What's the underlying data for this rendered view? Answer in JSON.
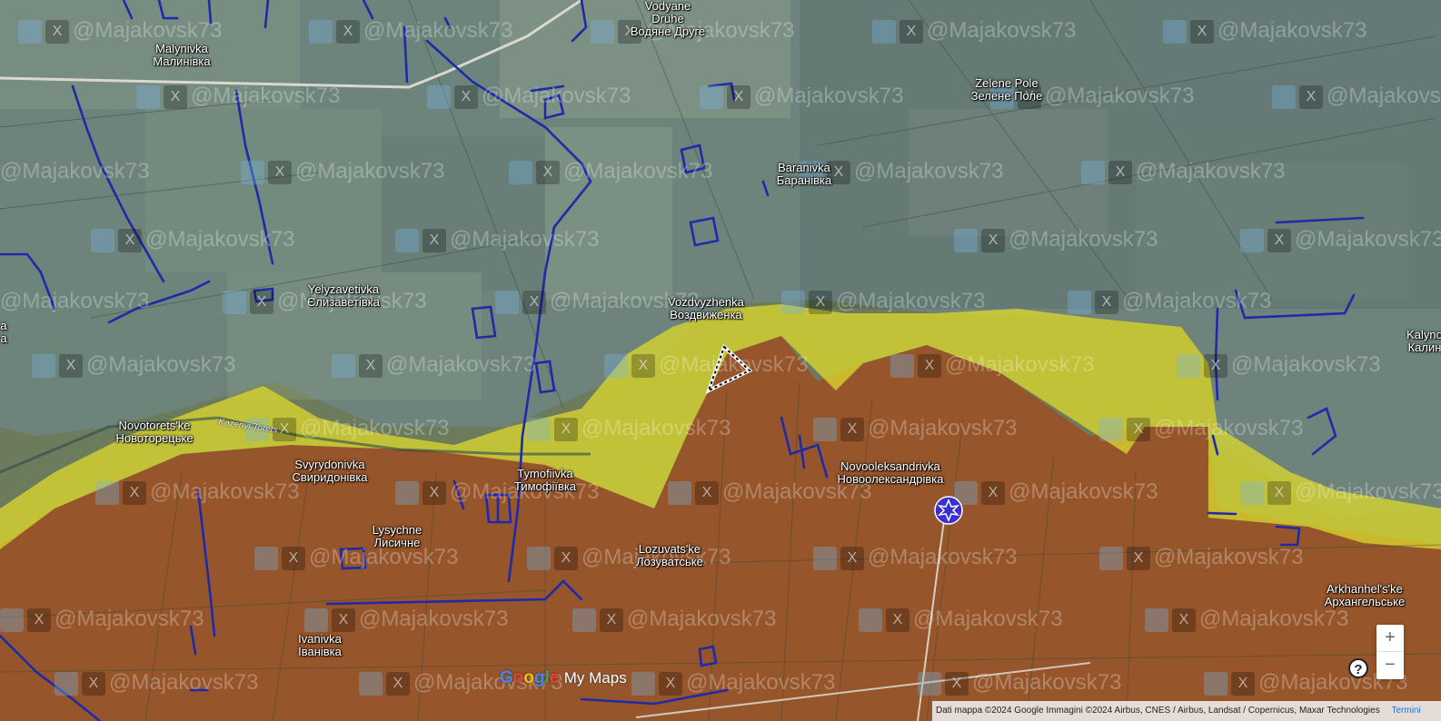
{
  "places": [
    {
      "id": "vodyane",
      "name_en": "Vodyane",
      "name_local": "Druhe",
      "name_local2": "Водяне Друге"
    },
    {
      "id": "malynivka",
      "name_en": "Malynivka",
      "name_local": "Малинівка"
    },
    {
      "id": "zelene",
      "name_en": "Zelene Pole",
      "name_local": "Зелене Поле"
    },
    {
      "id": "baranivka",
      "name_en": "Baranivka",
      "name_local": "Баранівка"
    },
    {
      "id": "yelyz",
      "name_en": "Yelyzavetivka",
      "name_local": "Єлизаветівка"
    },
    {
      "id": "vozd",
      "name_en": "Vozdvyzhenka",
      "name_local": "Воздвиженка"
    },
    {
      "id": "novotor",
      "name_en": "Novotorets'ke",
      "name_local": "Новоторецьке"
    },
    {
      "id": "svyr",
      "name_en": "Svyrydonivka",
      "name_local": "Свиридонівка"
    },
    {
      "id": "tymof",
      "name_en": "Tymofiivka",
      "name_local": "Тимофіївка"
    },
    {
      "id": "novool",
      "name_en": "Novooleksandrivka",
      "name_local": "Новоолександрівка"
    },
    {
      "id": "lysychne",
      "name_en": "Lysychne",
      "name_local": "Лисичне"
    },
    {
      "id": "lozuv",
      "name_en": "Lozuvats'ke",
      "name_local": "Лозуватське"
    },
    {
      "id": "ivanivka",
      "name_en": "Ivanivka",
      "name_local": "Іванівка"
    },
    {
      "id": "arkh",
      "name_en": "Arkhanhel's'ke",
      "name_local": "Архангельське"
    },
    {
      "id": "kalyn",
      "name_en": "Kalyno",
      "name_local": "Калин"
    },
    {
      "id": "a_edge",
      "name_en": "a",
      "name_local": "а"
    }
  ],
  "river_label": "Kazenyi Torets",
  "watermark": "@Majakovsk73",
  "logo": {
    "g": "G",
    "o1": "o",
    "o2": "o",
    "g2": "g",
    "l": "l",
    "e": "e",
    "rest": "My Maps"
  },
  "attribution": {
    "text": "Dati mappa ©2024 Google Immagini ©2024 Airbus, CNES / Airbus, Landsat / Copernicus, Maxar Technologies",
    "terms": "Termini"
  },
  "zoom": {
    "in": "+",
    "out": "−"
  },
  "help": "?",
  "colors": {
    "ukraine_control": "#6f8fa8",
    "contested": "#e4e034",
    "russia_control": "#b34a1a",
    "trench": "#1f2aa8",
    "marker": "#3a2fd0"
  }
}
